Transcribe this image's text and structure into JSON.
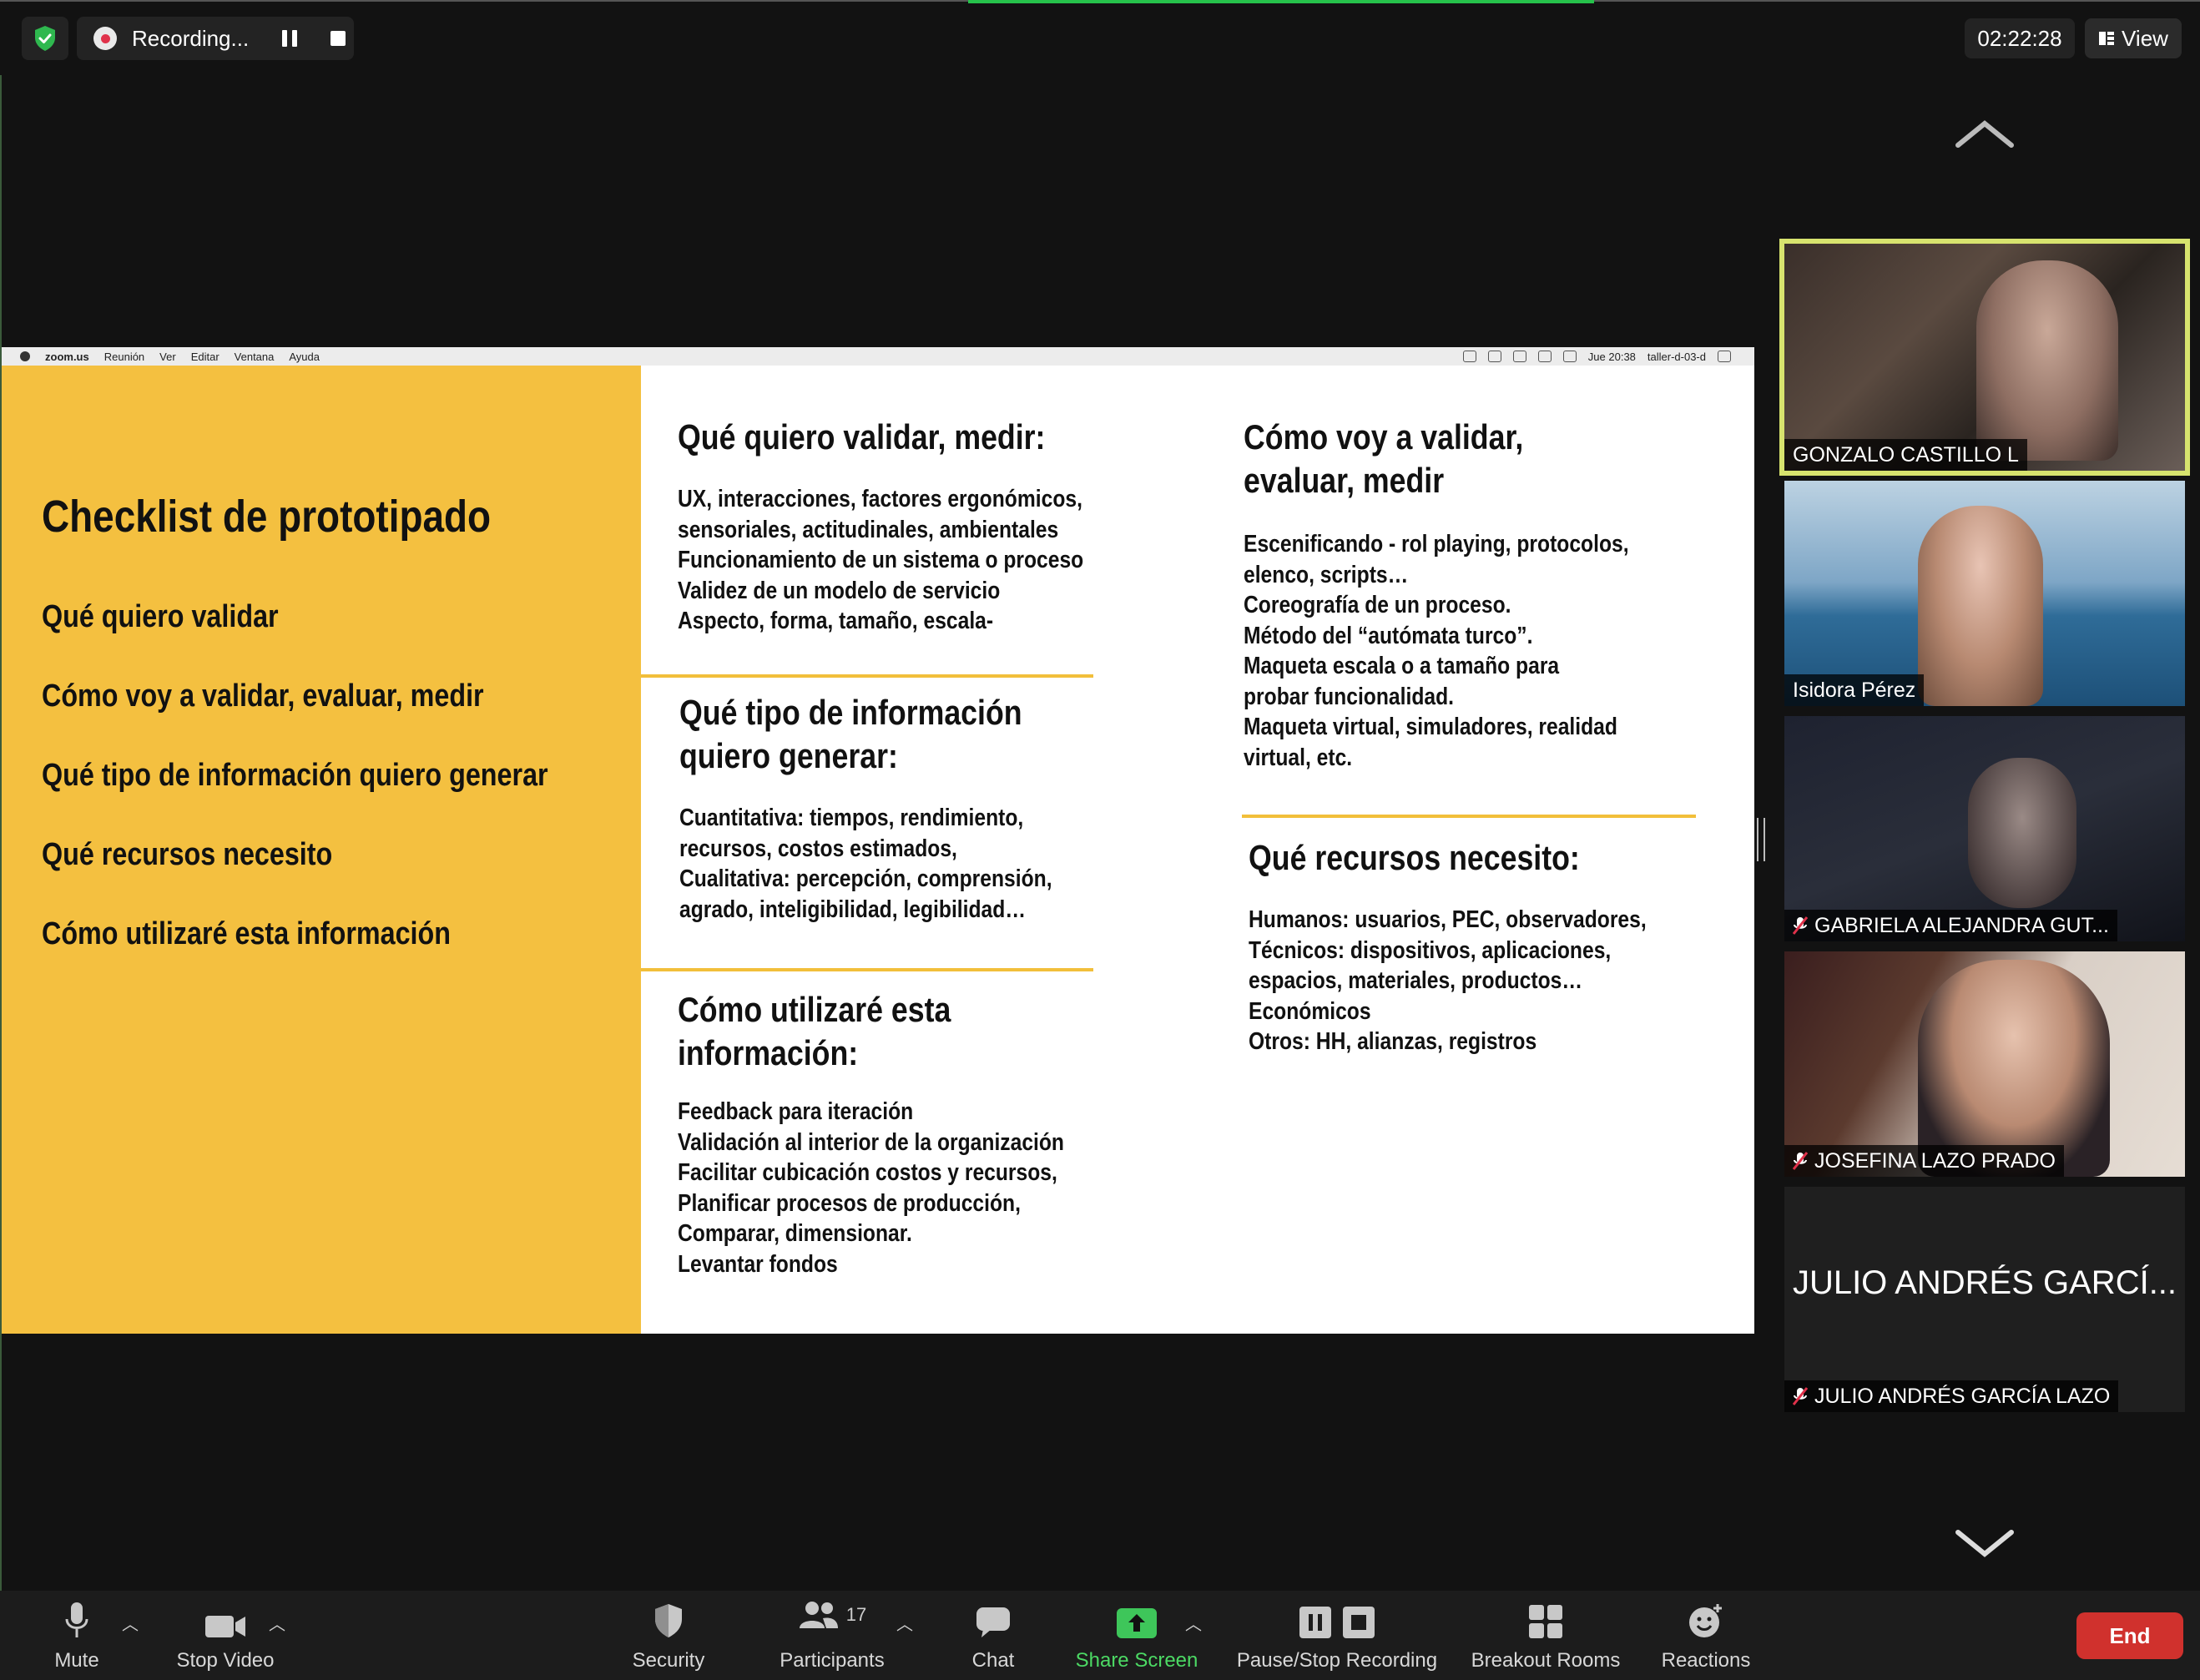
{
  "topbar": {
    "recording_label": "Recording...",
    "timer": "02:22:28",
    "view_label": "View"
  },
  "mac_menubar": {
    "items": [
      "zoom.us",
      "Reunión",
      "Ver",
      "Editar",
      "Ventana",
      "Ayuda"
    ],
    "clock": "Jue 20:38",
    "user": "taller-d-03-d"
  },
  "slide": {
    "title": "Checklist de prototipado",
    "left_items": [
      "Qué quiero validar",
      "Cómo voy a validar, evaluar, medir",
      "Qué tipo de información quiero generar",
      "Qué recursos necesito",
      "Cómo utilizaré esta información"
    ],
    "sections": [
      {
        "title": "Qué quiero validar, medir:",
        "body": [
          "UX, interacciones, factores ergonómicos,",
          "sensoriales, actitudinales, ambientales",
          "Funcionamiento de un sistema o proceso",
          "Validez de un modelo de servicio",
          "Aspecto, forma, tamaño, escala-"
        ]
      },
      {
        "title": "Qué tipo de información quiero generar:",
        "title_lines": [
          "Qué tipo de información",
          "quiero generar:"
        ],
        "body": [
          "Cuantitativa: tiempos, rendimiento,",
          "recursos, costos estimados,",
          "Cualitativa: percepción, comprensión,",
          "agrado, inteligibilidad, legibilidad…"
        ]
      },
      {
        "title_lines": [
          "Cómo utilizaré esta",
          "información:"
        ],
        "body": [
          "Feedback para iteración",
          "Validación al interior de la organización",
          "Facilitar cubicación costos y recursos,",
          "Planificar procesos de producción,",
          "Comparar, dimensionar.",
          "Levantar fondos"
        ]
      },
      {
        "title_lines": [
          "Cómo voy a validar,",
          "evaluar, medir"
        ],
        "body": [
          "Escenificando - rol playing, protocolos,",
          "elenco, scripts…",
          "Coreografía de un proceso.",
          "Método del “autómata turco”.",
          "Maqueta escala o a tamaño para",
          "probar  funcionalidad.",
          "Maqueta virtual, simuladores, realidad",
          "virtual, etc."
        ]
      },
      {
        "title": "Qué recursos necesito:",
        "body": [
          "Humanos: usuarios, PEC, observadores,",
          "Técnicos: dispositivos, aplicaciones,",
          "espacios, materiales, productos…",
          "Económicos",
          "Otros: HH, alianzas, registros"
        ]
      }
    ]
  },
  "participants": [
    {
      "name": "GONZALO CASTILLO L",
      "muted": false,
      "active": true
    },
    {
      "name": "Isidora Pérez",
      "muted": false,
      "active": false
    },
    {
      "name": "GABRIELA ALEJANDRA GUT...",
      "muted": true,
      "active": false
    },
    {
      "name": "JOSEFINA  LAZO  PRADO",
      "muted": true,
      "active": false
    },
    {
      "name": "JULIO ANDRÉS GARCÍA LAZO",
      "display_name": "JULIO ANDRÉS GARCÍ...",
      "muted": true,
      "active": false
    }
  ],
  "toolbar": {
    "mute": "Mute",
    "stop_video": "Stop Video",
    "security": "Security",
    "participants": "Participants",
    "participants_count": "17",
    "chat": "Chat",
    "share_screen": "Share Screen",
    "pause_stop_recording": "Pause/Stop Recording",
    "breakout_rooms": "Breakout Rooms",
    "reactions": "Reactions",
    "end": "End"
  },
  "colors": {
    "background": "#121212",
    "slide_yellow": "#f4c040",
    "share_green": "#4cd964",
    "end_red": "#d0312d",
    "active_speaker": "#d7e36e"
  }
}
